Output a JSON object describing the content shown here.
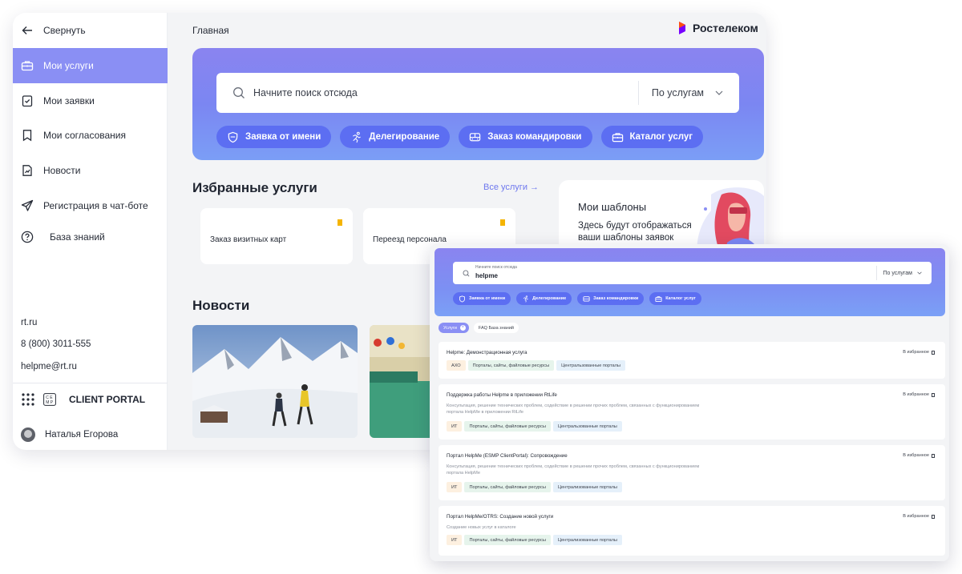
{
  "sidebar": {
    "collapse_label": "Свернуть",
    "items": [
      {
        "label": "Мои услуги",
        "active": true
      },
      {
        "label": "Мои заявки"
      },
      {
        "label": "Мои согласования"
      },
      {
        "label": "Новости"
      },
      {
        "label": "Регистрация в чат-боте"
      },
      {
        "label": "База знаний"
      }
    ],
    "contacts": [
      "rt.ru",
      "8 (800) 3011-555",
      "helpme@rt.ru"
    ],
    "portal_badge": "C E M P",
    "portal_title": "CLIENT PORTAL",
    "user_name": "Наталья Егорова"
  },
  "header": {
    "breadcrumb": "Главная",
    "logo_text": "Ростелеком"
  },
  "colors": {
    "accent": "#8a8ff4",
    "chip": "#5c6ef2",
    "logo_orange": "#ff4f12",
    "logo_purple": "#7700ff",
    "bookmark": "#f5b400"
  },
  "search": {
    "placeholder": "Начните поиск отсюда",
    "scope": "По услугам"
  },
  "quick_actions": [
    {
      "label": "Заявка от имени",
      "icon": "shield-icon"
    },
    {
      "label": "Делегирование",
      "icon": "runner-icon"
    },
    {
      "label": "Заказ командировки",
      "icon": "bus-icon"
    },
    {
      "label": "Каталог услуг",
      "icon": "briefcase-icon"
    }
  ],
  "favorites": {
    "title": "Избранные услуги",
    "all_link": "Все услуги →",
    "items": [
      "Заказ визитных карт",
      "Переезд персонала"
    ]
  },
  "templates": {
    "title": "Мои шаблоны",
    "text": "Здесь будут отображаться ваши шаблоны заявок"
  },
  "news": {
    "title": "Новости"
  },
  "results_window": {
    "search_label": "Начните поиск отсюда",
    "search_value": "helpme",
    "scope": "По услугам",
    "filters": {
      "active": "Услуги",
      "other": "FAQ База знаний"
    },
    "fav_label": "В избранное",
    "results": [
      {
        "title": "Helpme: Демонстрационная услуга",
        "desc": "",
        "tags": [
          "АХО",
          "Порталы, сайты, файловые ресурсы",
          "Центральзованные порталы"
        ]
      },
      {
        "title": "Поддержка работы Helpme в приложении RtLife",
        "desc": "Консультация, решение технических проблем, содействие в решении прочих проблем, связанных с функционированием портала HelpMe в приложении RtLife",
        "tags": [
          "ИТ",
          "Порталы, сайты, файловые ресурсы",
          "Центральзованные порталы"
        ]
      },
      {
        "title": "Портал HelpMe (ESMP ClientPortal): Сопровождение",
        "desc": "Консультация, решение технических проблем, содействие в решении прочих проблем, связанных с функционированием портала HelpMe",
        "tags": [
          "ИТ",
          "Порталы, сайты, файловые ресурсы",
          "Централизованные порталы"
        ]
      },
      {
        "title": "Портал HelpMe/OTRS: Создание новой услуги",
        "desc": "Создание новых услуг в каталоге",
        "tags": [
          "ИТ",
          "Порталы, сайты, файловые ресурсы",
          "Централизованные порталы"
        ]
      }
    ]
  }
}
